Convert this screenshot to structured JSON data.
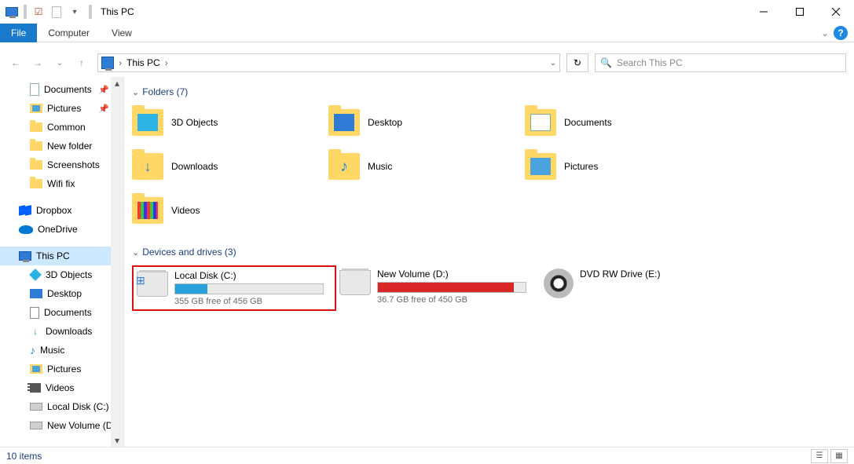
{
  "window": {
    "title": "This PC"
  },
  "ribbon": {
    "file": "File",
    "tabs": [
      "Computer",
      "View"
    ]
  },
  "address": {
    "crumb": "This PC"
  },
  "search": {
    "placeholder": "Search This PC"
  },
  "sidebar": {
    "quick": [
      {
        "label": "Documents",
        "icon": "doc",
        "pinned": true
      },
      {
        "label": "Pictures",
        "icon": "pic",
        "pinned": true
      },
      {
        "label": "Common",
        "icon": "folder"
      },
      {
        "label": "New folder",
        "icon": "folder"
      },
      {
        "label": "Screenshots",
        "icon": "folder"
      },
      {
        "label": "Wifi fix",
        "icon": "folder"
      }
    ],
    "cloud": [
      {
        "label": "Dropbox",
        "icon": "dropbox"
      },
      {
        "label": "OneDrive",
        "icon": "onedrive"
      }
    ],
    "thispc": {
      "label": "This PC"
    },
    "pcchildren": [
      {
        "label": "3D Objects",
        "icon": "cube"
      },
      {
        "label": "Desktop",
        "icon": "desk"
      },
      {
        "label": "Documents",
        "icon": "doc2"
      },
      {
        "label": "Downloads",
        "icon": "down"
      },
      {
        "label": "Music",
        "icon": "music"
      },
      {
        "label": "Pictures",
        "icon": "pic"
      },
      {
        "label": "Videos",
        "icon": "vid"
      },
      {
        "label": "Local Disk (C:)",
        "icon": "disk"
      },
      {
        "label": "New Volume (D:)",
        "icon": "disk"
      }
    ]
  },
  "groups": {
    "folders": {
      "header": "Folders (7)",
      "items": [
        {
          "label": "3D Objects",
          "inner": "cube"
        },
        {
          "label": "Desktop",
          "inner": "desk"
        },
        {
          "label": "Documents",
          "inner": "doc"
        },
        {
          "label": "Downloads",
          "inner": "down"
        },
        {
          "label": "Music",
          "inner": "music"
        },
        {
          "label": "Pictures",
          "inner": "pic"
        },
        {
          "label": "Videos",
          "inner": "vid"
        }
      ]
    },
    "drives": {
      "header": "Devices and drives (3)",
      "items": [
        {
          "label": "Local Disk (C:)",
          "free": "355 GB free of 456 GB",
          "fill_pct": 22,
          "color": "blue",
          "highlighted": true,
          "type": "hdd-win"
        },
        {
          "label": "New Volume (D:)",
          "free": "36.7 GB free of 450 GB",
          "fill_pct": 92,
          "color": "red",
          "type": "hdd"
        },
        {
          "label": "DVD RW Drive (E:)",
          "type": "dvd"
        }
      ]
    }
  },
  "status": {
    "text": "10 items"
  }
}
